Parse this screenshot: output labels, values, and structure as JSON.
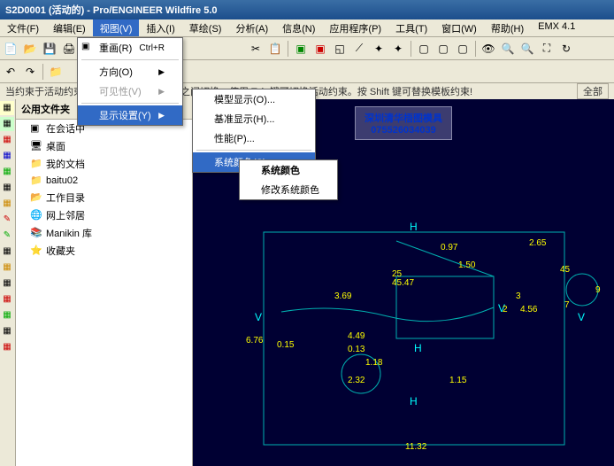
{
  "title": "S2D0001 (活动的) - Pro/ENGINEER Wildfire 5.0",
  "menu": {
    "items": [
      "文件(F)",
      "编辑(E)",
      "视图(V)",
      "插入(I)",
      "草绘(S)",
      "分析(A)",
      "信息(N)",
      "应用程序(P)",
      "工具(T)",
      "窗口(W)",
      "帮助(H)",
      "EMX 4.1"
    ]
  },
  "view_menu": {
    "repaint": "重画(R)",
    "repaint_key": "Ctrl+R",
    "direction": "方向(O)",
    "visibility": "可见性(V)",
    "display_settings": "显示设置(Y)"
  },
  "display_submenu": {
    "model_display": "模型显示(O)...",
    "datum_display": "基准显示(H)...",
    "performance": "性能(P)...",
    "system_colors": "系统颜色(S)..."
  },
  "colors_submenu": {
    "system_colors": "系统颜色",
    "modify_colors": "修改系统颜色"
  },
  "status": {
    "msg": "当约束于活动约束之间时，用右键在约束之间切换。使用 Tab 键可切换活动约束。按 Shift 键可替换模板约束!",
    "right": "全部"
  },
  "tree": {
    "header": "公用文件夹",
    "items": [
      "在会话中",
      "桌面",
      "我的文档",
      "baitu02",
      "工作目录",
      "网上邻居",
      "Manikin 库",
      "收藏夹"
    ]
  },
  "watermark": {
    "line1": "深圳清华梧图模具",
    "line2": "075526034039"
  },
  "dims": {
    "d1": "0.97",
    "d2": "1.50",
    "d3": "2.65",
    "d4": "45",
    "d5": "45.47",
    "d6": "25",
    "d7": "3.69",
    "d8": "4.56",
    "d9": "6.76",
    "d10": "4.49",
    "d11": "0.15",
    "d12": "0.13",
    "d13": "1.18",
    "d14": "2.32",
    "d15": "1.15",
    "d16": "11.32",
    "d17": "9",
    "d18": "3",
    "d19": "2",
    "d20": "7",
    "h": "H",
    "v": "V"
  }
}
